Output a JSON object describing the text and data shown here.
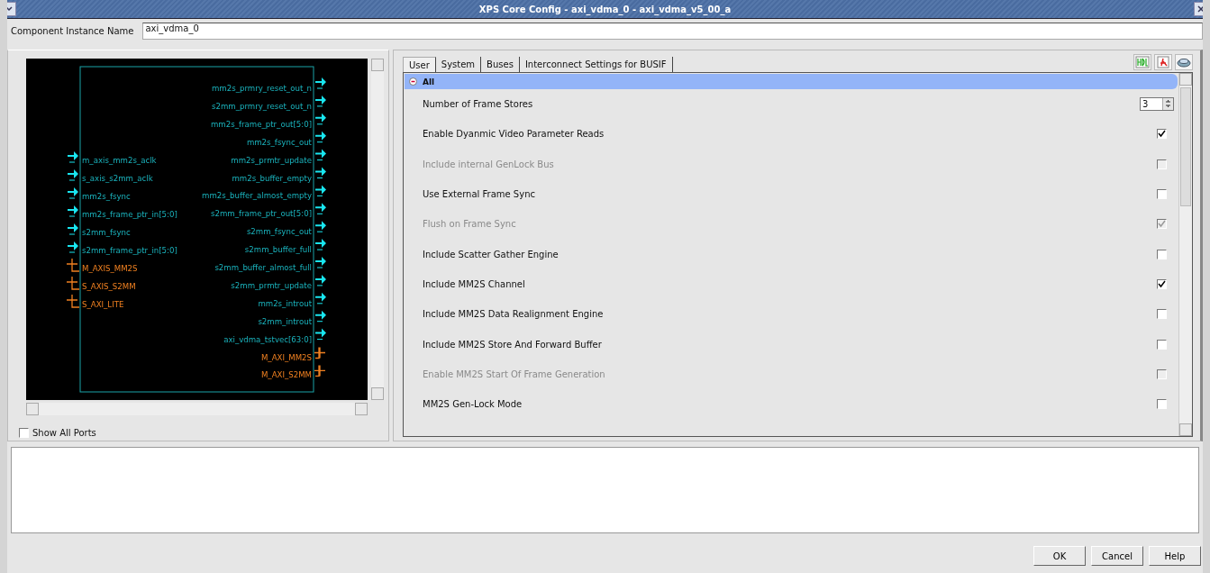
{
  "window": {
    "title": "XPS Core Config - axi_vdma_0 - axi_vdma_v5_00_a"
  },
  "instance": {
    "label": "Component Instance Name",
    "value": "axi_vdma_0"
  },
  "diagram": {
    "left_ports": [
      {
        "name": "m_axis_mm2s_aclk",
        "kind": "signal"
      },
      {
        "name": "s_axis_s2mm_aclk",
        "kind": "signal"
      },
      {
        "name": "mm2s_fsync",
        "kind": "signal"
      },
      {
        "name": "mm2s_frame_ptr_in[5:0]",
        "kind": "signal"
      },
      {
        "name": "s2mm_fsync",
        "kind": "signal"
      },
      {
        "name": "s2mm_frame_ptr_in[5:0]",
        "kind": "signal"
      },
      {
        "name": "M_AXIS_MM2S",
        "kind": "bus"
      },
      {
        "name": "S_AXIS_S2MM",
        "kind": "bus"
      },
      {
        "name": "S_AXI_LITE",
        "kind": "bus"
      }
    ],
    "right_ports": [
      {
        "name": "mm2s_prmry_reset_out_n",
        "kind": "signal"
      },
      {
        "name": "s2mm_prmry_reset_out_n",
        "kind": "signal"
      },
      {
        "name": "mm2s_frame_ptr_out[5:0]",
        "kind": "signal"
      },
      {
        "name": "mm2s_fsync_out",
        "kind": "signal"
      },
      {
        "name": "mm2s_prmtr_update",
        "kind": "signal"
      },
      {
        "name": "mm2s_buffer_empty",
        "kind": "signal"
      },
      {
        "name": "mm2s_buffer_almost_empty",
        "kind": "signal"
      },
      {
        "name": "s2mm_frame_ptr_out[5:0]",
        "kind": "signal"
      },
      {
        "name": "s2mm_fsync_out",
        "kind": "signal"
      },
      {
        "name": "s2mm_buffer_full",
        "kind": "signal"
      },
      {
        "name": "s2mm_buffer_almost_full",
        "kind": "signal"
      },
      {
        "name": "s2mm_prmtr_update",
        "kind": "signal"
      },
      {
        "name": "mm2s_introut",
        "kind": "signal"
      },
      {
        "name": "s2mm_introut",
        "kind": "signal"
      },
      {
        "name": "axi_vdma_tstvec[63:0]",
        "kind": "signal"
      },
      {
        "name": "M_AXI_MM2S",
        "kind": "bus"
      },
      {
        "name": "M_AXI_S2MM",
        "kind": "bus"
      }
    ],
    "show_all_ports": {
      "label": "Show All Ports",
      "checked": false
    }
  },
  "tabs": [
    {
      "label": "User",
      "selected": true
    },
    {
      "label": "System",
      "selected": false
    },
    {
      "label": "Buses",
      "selected": false
    },
    {
      "label": "Interconnect Settings for BUSIF",
      "selected": false
    }
  ],
  "group": {
    "label": "All",
    "expanded": true
  },
  "params": [
    {
      "label": "Number of Frame Stores",
      "kind": "spin",
      "value": "3",
      "disabled": false
    },
    {
      "label": "Enable Dyanmic Video Parameter Reads",
      "kind": "check",
      "checked": true,
      "disabled": false
    },
    {
      "label": "Include internal GenLock Bus",
      "kind": "check",
      "checked": false,
      "disabled": true
    },
    {
      "label": "Use External Frame Sync",
      "kind": "check",
      "checked": false,
      "disabled": false
    },
    {
      "label": "Flush on Frame Sync",
      "kind": "check",
      "checked": true,
      "disabled": true
    },
    {
      "label": "Include Scatter Gather Engine",
      "kind": "check",
      "checked": false,
      "disabled": false
    },
    {
      "label": "Include MM2S Channel",
      "kind": "check",
      "checked": true,
      "disabled": false
    },
    {
      "label": "Include MM2S Data Realignment Engine",
      "kind": "check",
      "checked": false,
      "disabled": false
    },
    {
      "label": "Include MM2S Store And Forward Buffer",
      "kind": "check",
      "checked": false,
      "disabled": false
    },
    {
      "label": "Enable MM2S Start Of Frame Generation",
      "kind": "check",
      "checked": false,
      "disabled": true
    },
    {
      "label": "MM2S Gen-Lock Mode",
      "kind": "check",
      "checked": false,
      "disabled": false
    }
  ],
  "buttons": [
    "OK",
    "Cancel",
    "Help"
  ]
}
